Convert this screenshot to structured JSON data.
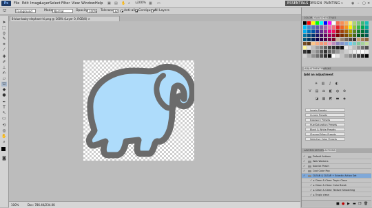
{
  "app": {
    "logo": "Ps"
  },
  "menu": [
    "File",
    "Edit",
    "Image",
    "Layer",
    "Select",
    "Filter",
    "View",
    "Window",
    "Help"
  ],
  "header_controls": {
    "zoom": "100%"
  },
  "workspaces": {
    "active": "ESSENTIALS",
    "others": [
      "DESIGN",
      "PAINTING",
      "»"
    ]
  },
  "options": {
    "tool_icon": "paint-bucket-icon",
    "fill_source": "Foreground",
    "mode_label": "Mode:",
    "mode_value": "Normal",
    "opacity_label": "Opacity:",
    "opacity_value": "100%",
    "tolerance_label": "Tolerance:",
    "tolerance_value": "32",
    "antialias_label": "Anti-alias",
    "contiguous_label": "Contiguous",
    "all_layers_label": "All Layers"
  },
  "document": {
    "tab_title": "8-blue-baby-elephant-hi.png @ 100% (Layer 0, RGB/8) ×",
    "zoom": "100%",
    "doc_info": "Doc: 786.4K/234.0K",
    "elephant_colors": {
      "outline": "#6b6b6b",
      "fill": "#aedcfb",
      "eye": "#1b1b1b"
    }
  },
  "swatches_panel": {
    "tabs": [
      "COLOR",
      "SWATCHES",
      "STYLES"
    ],
    "active_tab": "SWATCHES",
    "colors": [
      "#000000",
      "#ff0000",
      "#ffff00",
      "#00ff00",
      "#00ffff",
      "#0000ff",
      "#ff00ff",
      "#ffffff",
      "#f26c4f",
      "#f68e55",
      "#fbaf5c",
      "#fff467",
      "#acd372",
      "#7cc576",
      "#3bb878",
      "#1abbb4",
      "#00bff3",
      "#438ccb",
      "#5574b9",
      "#605ca8",
      "#855fa8",
      "#a763a8",
      "#f06ea9",
      "#f26d7d",
      "#ed1c24",
      "#f26522",
      "#f7941d",
      "#fff200",
      "#8dc63f",
      "#39b54a",
      "#00a651",
      "#00a99d",
      "#00aeef",
      "#0072bc",
      "#0054a6",
      "#2e3192",
      "#662d91",
      "#92278f",
      "#ec008c",
      "#ed145b",
      "#9e0b0f",
      "#a0410d",
      "#a36209",
      "#aba000",
      "#598527",
      "#1a7b30",
      "#007236",
      "#00746b",
      "#0076a3",
      "#004b80",
      "#003471",
      "#1b1464",
      "#440e62",
      "#630460",
      "#9e005d",
      "#9e0039",
      "#790000",
      "#7b2e00",
      "#7d4900",
      "#827b00",
      "#406618",
      "#005e20",
      "#005826",
      "#005952",
      "#005b7f",
      "#003663",
      "#002157",
      "#0d004c",
      "#32004b",
      "#4b0049",
      "#7b0046",
      "#7a0026",
      "#c7b299",
      "#998675",
      "#736357",
      "#534741",
      "#37302d",
      "#c69c6d",
      "#a67c52",
      "#8c6239",
      "#754c24",
      "#603913",
      "#fdc68a",
      "#f9ad81",
      "#f69679",
      "#f7977a",
      "#f49ac2",
      "#bd8cbf",
      "#8781bd",
      "#8493ca",
      "#7da7d9",
      "#6dcff6",
      "#7accc8",
      "#82ca9d",
      "#a3d39c",
      "#c4df9b",
      "#fff799",
      "#e0e0e0",
      "#c0c0c0",
      "#a0a0a0",
      "#808080",
      "#606060",
      "#404040",
      "#303030",
      "#202020",
      "#101010",
      "#ededed",
      "#d6d6d6",
      "#bcbcbc",
      "#959595",
      "#707070",
      "#505050",
      "#363636",
      "#1c1c1c",
      "#aaaaaa",
      "#8a8a8a",
      "#555555",
      "#333333",
      "#666666",
      "#777777",
      "#999999",
      "#bbbbbb",
      "#cccccc",
      "#dddddd",
      "#eeeeee",
      "#f5f5f5",
      "#fafafa",
      "#e8e8e8",
      "#d0d0d0",
      "#b0b0b0",
      "#909090",
      "#707070",
      "#505050",
      "#303030",
      "#101010",
      "#fefefe",
      "#e4e4e4",
      "#c4c4c4",
      "#a4a4a4",
      "#848484",
      "#646464",
      "#444444",
      "#242424",
      "#040404",
      "#efefef",
      "#cfcfcf",
      "#afafaf",
      "#8f8f8f",
      "#6f6f6f",
      "#4f4f4f",
      "#2f2f2f"
    ]
  },
  "adjustments_panel": {
    "tabs": [
      "ADJUSTMENTS",
      "MASKS"
    ],
    "title": "Add an adjustment",
    "presets": [
      "Levels Presets",
      "Curves Presets",
      "Exposure Presets",
      "Hue/Saturation Presets",
      "Black & White Presets",
      "Channel Mixer Presets",
      "Selective Color Presets"
    ]
  },
  "layers_panel": {
    "tabs": [
      "LAYERS",
      "HISTORY",
      "ACTIONS"
    ],
    "active_tab": "ACTIONS",
    "rows": [
      {
        "label": "Default Actions",
        "kind": "folder"
      },
      {
        "label": "Web Warbers",
        "kind": "folder"
      },
      {
        "label": "Kubrick Peach",
        "kind": "folder"
      },
      {
        "label": "Cool Color Pop",
        "kind": "folder"
      },
      {
        "label": "CLEAN & CLEAR + Eclectic Action Set",
        "kind": "folder",
        "selected": true
      },
      {
        "label": "Clean & Clear: Tropic Clean",
        "kind": "action"
      },
      {
        "label": "Clean & Clear: Color Break",
        "kind": "action"
      },
      {
        "label": "Clean & Clear: Texture Smoothing",
        "kind": "action"
      },
      {
        "label": "Tropic clean",
        "kind": "action"
      }
    ]
  }
}
